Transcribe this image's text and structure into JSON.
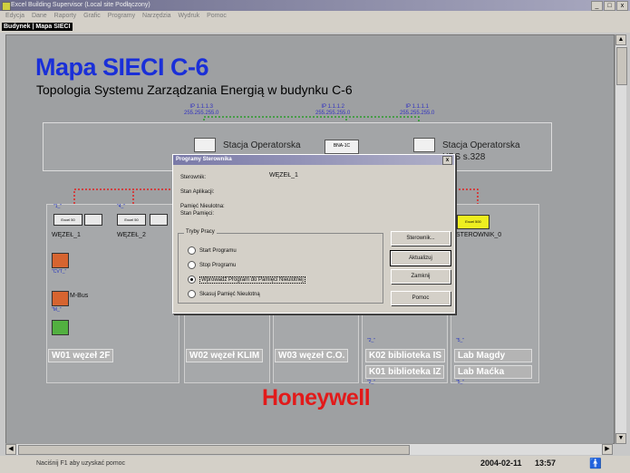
{
  "window": {
    "title": "Excel Building Supervisor (Local site Podłączony)",
    "controls": [
      "_",
      "□",
      "x"
    ]
  },
  "menu": [
    "Edycja",
    "Dane",
    "Raporty",
    "Grafic",
    "Programy",
    "Narzędzia",
    "Wydruk",
    "Pomoc"
  ],
  "tab": {
    "label": "Budynek | Mapa SIECI"
  },
  "map": {
    "title": "Mapa SIECI C-6",
    "subtitle": "Topologia Systemu Zarządzania Energią w budynku C-6",
    "ip": [
      {
        "addr": "IP 1.1.1.3",
        "mask": "255.255.255.0"
      },
      {
        "addr": "IP 1.1.1.2",
        "mask": "255.255.255.0"
      },
      {
        "addr": "IP 1.1.1.1",
        "mask": "255.255.255.0"
      }
    ],
    "stations": {
      "left": "Stacja Operatorska",
      "mid_device": "BNA-1C",
      "right_line1": "Stacja Operatorska",
      "right_line2": "XBS s.328"
    },
    "controllers": {
      "c1": "Excel 50",
      "c2": "Excel 50",
      "c3": "Excel 500",
      "tag1": "\"1_\"",
      "tag2": "\"4_\""
    },
    "nodes": {
      "wezel1": "WĘZEŁ_1",
      "wezel2": "WĘZEŁ_2",
      "sterownik": "STEROWNIK_0"
    },
    "devices": {
      "tag_cvt": "\"CVT_\"",
      "mbus_label": "M-Bus",
      "tag_m": "\"M_\"",
      "tag_2a": "\"2_\"",
      "tag_2b": "\"2_\"",
      "tag_5a": "\"5_\"",
      "tag_5b": "\"5_\""
    },
    "groups": {
      "w01": "W01 węzeł 2F",
      "w02": "W02 węzeł KLIM",
      "w03": "W03 węzeł C.O.",
      "k02": "K02 biblioteka IS",
      "k01": "K01 biblioteka IZ",
      "lab_magdy": "Lab Magdy",
      "lab_macka": "Lab Maćka"
    },
    "logo": "Honeywell"
  },
  "dialog": {
    "title": "Programy Sterownika",
    "close": "x",
    "sterownik_label": "Sterownik:",
    "sterownik_value": "WĘZEŁ_1",
    "stan_aplikacji": "Stan Aplikacji:",
    "pamiec_nieulotna": "Pamięć Nieulotna:",
    "stan_pamieci": "Stan Pamięci:",
    "tryby_legend": "Tryby Pracy",
    "options": [
      {
        "label": "Start Programu",
        "selected": false
      },
      {
        "label": "Stop Programu",
        "selected": false
      },
      {
        "label": "Wprowadź Program do Pamięci Nieulotnej",
        "selected": true
      },
      {
        "label": "Skasuj Pamięć Nieulotną",
        "selected": false
      }
    ],
    "buttons": {
      "sterownik": "Sterownik...",
      "aktualizuj": "Aktualizuj",
      "zamknij": "Zamknij",
      "pomoc": "Pomoc"
    }
  },
  "status": {
    "hint": "Naciśnij F1 aby uzyskać pomoc",
    "date": "2004-02-11",
    "time": "13:57"
  },
  "colors": {
    "title_blue": "#1a2fd8",
    "honeywell_red": "#e21a1a",
    "net_red": "#e02020",
    "net_green": "#2a9a2a",
    "net_blue": "#3030d0"
  }
}
